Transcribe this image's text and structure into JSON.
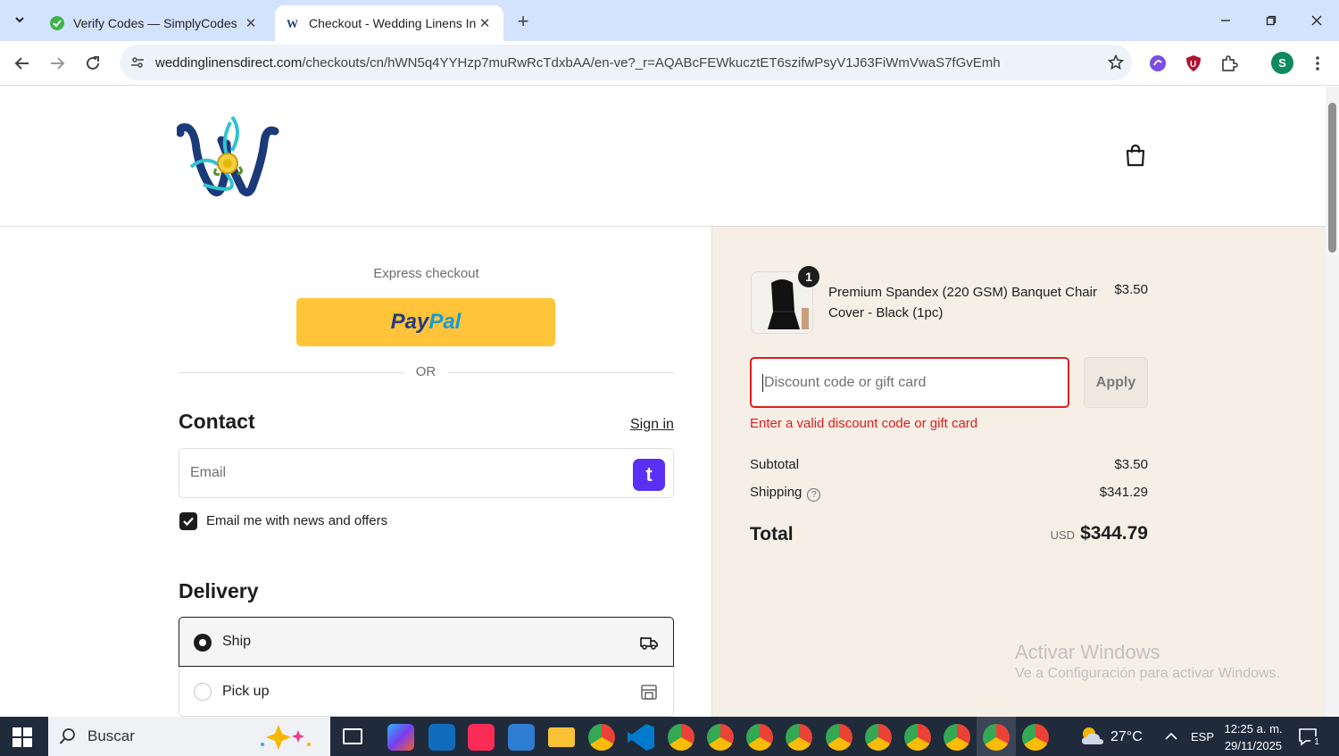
{
  "browser": {
    "tabs": [
      {
        "title": "Verify Codes — SimplyCodes",
        "active": false,
        "favicon": "simplycodes-icon"
      },
      {
        "title": "Checkout - Wedding Linens Inc.",
        "active": true,
        "favicon": "wedding-linens-icon"
      }
    ],
    "url_domain": "weddinglinensdirect.com",
    "url_path": "/checkouts/cn/hWN5q4YYHzp7muRwRcTdxbAA/en-ve?_r=AQABcFEWkucztET6szifwPsyV1J63FiWmVwaS7fGvEmh",
    "profile_initial": "S"
  },
  "checkout": {
    "express_label": "Express checkout",
    "paypal_label_1": "Pay",
    "paypal_label_2": "Pal",
    "or_label": "OR",
    "contact_heading": "Contact",
    "sign_in_label": "Sign in",
    "email_placeholder": "Email",
    "shop_badge": "t",
    "newsletter_label": "Email me with news and offers",
    "newsletter_checked": true,
    "delivery_heading": "Delivery",
    "delivery_options": [
      {
        "label": "Ship",
        "selected": true
      },
      {
        "label": "Pick up",
        "selected": false
      }
    ]
  },
  "summary": {
    "item": {
      "quantity": "1",
      "name": "Premium Spandex (220 GSM) Banquet Chair Cover - Black (1pc)",
      "price": "$3.50"
    },
    "discount_placeholder": "Discount code or gift card",
    "apply_label": "Apply",
    "error": "Enter a valid discount code or gift card",
    "subtotal_label": "Subtotal",
    "subtotal_value": "$3.50",
    "shipping_label": "Shipping",
    "shipping_value": "$341.29",
    "total_label": "Total",
    "total_currency": "USD",
    "total_value": "$344.79"
  },
  "watermark": {
    "line1": "Activar Windows",
    "line2": "Ve a Configuración para activar Windows."
  },
  "taskbar": {
    "search_label": "Buscar",
    "weather": "27°C",
    "language": "ESP",
    "time": "12:25 a. m.",
    "date": "29/11/2025",
    "notifications": "1"
  },
  "colors": {
    "paypal": "#ffc439",
    "error": "#dd1d1d",
    "summary_bg": "#f6efe6",
    "shop_pay": "#5a31f4"
  }
}
